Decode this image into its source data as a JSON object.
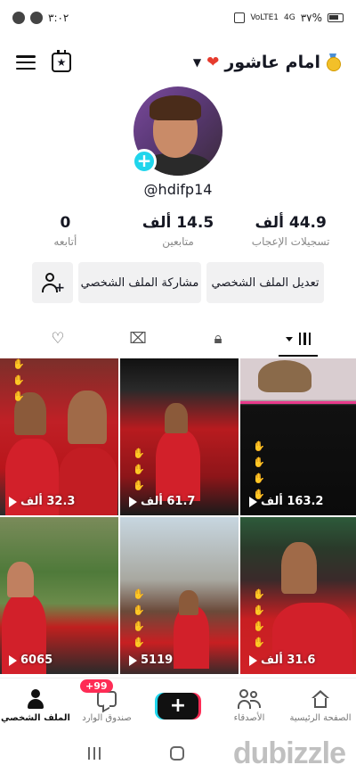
{
  "status_bar": {
    "time": "٣:٠٢",
    "battery_percent": "٣٧%",
    "network": "4G",
    "volte": "VoLTE1"
  },
  "header": {
    "title": "امام عاشور"
  },
  "profile": {
    "username": "@hdifp14"
  },
  "stats": [
    {
      "value": "0",
      "label": "أتابعه"
    },
    {
      "value": "14.5 ألف",
      "label": "متابعين"
    },
    {
      "value": "44.9 ألف",
      "label": "تسجيلات الإعجاب"
    }
  ],
  "actions": {
    "edit_profile": "تعديل الملف الشخصي",
    "share_profile": "مشاركة الملف الشخصي"
  },
  "tabs": [
    "videos",
    "private",
    "reposts",
    "liked"
  ],
  "videos": [
    {
      "views": "32.3 ألف"
    },
    {
      "views": "61.7 ألف"
    },
    {
      "views": "163.2 ألف"
    },
    {
      "views": "6065"
    },
    {
      "views": "5119"
    },
    {
      "views": "31.6 ألف"
    }
  ],
  "bottom_nav": {
    "home": "الصفحة الرئيسية",
    "friends": "الأصدقاء",
    "inbox": "صندوق الوارد",
    "inbox_badge": "+99",
    "profile": "الملف الشخصي"
  },
  "watermark": "dubizzle",
  "colors": {
    "accent_cyan": "#20d5ec",
    "accent_pink": "#fe2c55"
  }
}
